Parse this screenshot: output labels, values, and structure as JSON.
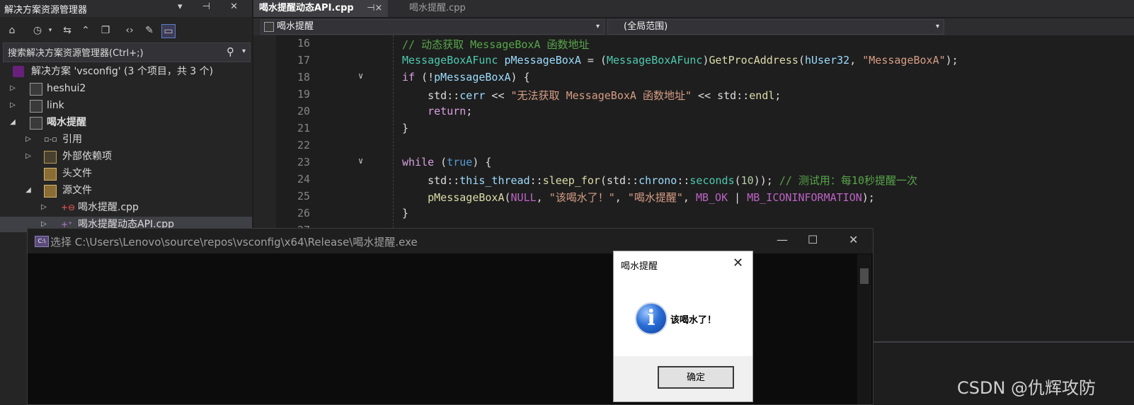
{
  "solution_explorer": {
    "title": "解决方案资源管理器",
    "search_placeholder": "搜索解决方案资源管理器(Ctrl+;)",
    "items": [
      {
        "label": "解决方案 'vsconfig' (3 个项目，共 3 个)"
      },
      {
        "label": "heshui2"
      },
      {
        "label": "link"
      },
      {
        "label": "喝水提醒"
      },
      {
        "label": "引用"
      },
      {
        "label": "外部依赖项"
      },
      {
        "label": "头文件"
      },
      {
        "label": "源文件"
      },
      {
        "label": "喝水提醒.cpp"
      },
      {
        "label": "喝水提醒动态API.cpp"
      }
    ]
  },
  "editor": {
    "tabs": [
      {
        "label": "喝水提醒动态API.cpp",
        "pin": "⊣×"
      },
      {
        "label": "喝水提醒.cpp"
      }
    ],
    "nav": {
      "project": "喝水提醒",
      "scope": "(全局范围)"
    },
    "line_numbers": [
      "16",
      "17",
      "18",
      "19",
      "20",
      "21",
      "22",
      "23",
      "24",
      "25",
      "26",
      "27"
    ]
  },
  "console": {
    "title": "选择 C:\\Users\\Lenovo\\source\\repos\\vsconfig\\x64\\Release\\喝水提醒.exe",
    "icon_text": "C:\\"
  },
  "message_box": {
    "title": "喝水提醒",
    "message": "该喝水了！",
    "ok_label": "确定",
    "icon": "information-icon"
  },
  "watermark": "CSDN @仇辉攻防"
}
